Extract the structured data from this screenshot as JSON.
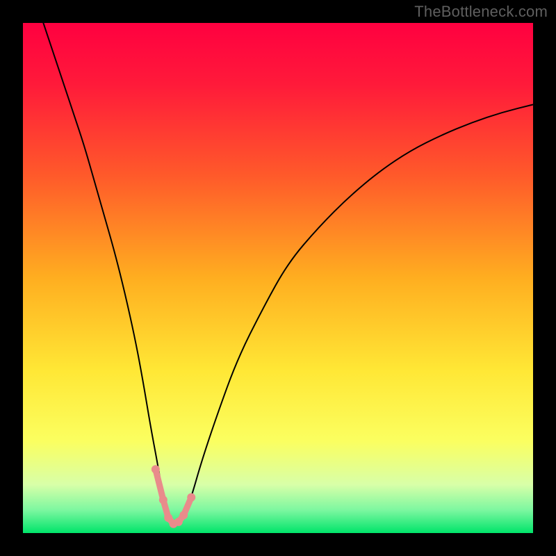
{
  "watermark": "TheBottleneck.com",
  "chart_data": {
    "type": "line",
    "title": "",
    "xlabel": "",
    "ylabel": "",
    "xlim": [
      0,
      100
    ],
    "ylim": [
      0,
      100
    ],
    "background": {
      "kind": "vertical-gradient",
      "stops": [
        {
          "pos": 0.0,
          "color": "#ff0040"
        },
        {
          "pos": 0.12,
          "color": "#ff1a3a"
        },
        {
          "pos": 0.3,
          "color": "#ff5a2a"
        },
        {
          "pos": 0.5,
          "color": "#ffae20"
        },
        {
          "pos": 0.68,
          "color": "#ffe735"
        },
        {
          "pos": 0.82,
          "color": "#fbff60"
        },
        {
          "pos": 0.905,
          "color": "#d8ffa8"
        },
        {
          "pos": 0.955,
          "color": "#7cf7a0"
        },
        {
          "pos": 1.0,
          "color": "#00e46a"
        }
      ]
    },
    "series": [
      {
        "name": "bottleneck-curve",
        "stroke": "#000000",
        "stroke_width": 2,
        "x": [
          4,
          6,
          8,
          10,
          12,
          14,
          16,
          18,
          20,
          22,
          23.5,
          25,
          26.5,
          27.5,
          28.5,
          30,
          31.5,
          33,
          35,
          38,
          42,
          47,
          52,
          58,
          64,
          70,
          76,
          82,
          88,
          94,
          100
        ],
        "y_pct": [
          100,
          94,
          88,
          82,
          76,
          69,
          62,
          55,
          47,
          38,
          30,
          21,
          13,
          7,
          3,
          1.5,
          3,
          7,
          14,
          23,
          34,
          44,
          53,
          60,
          66,
          71,
          75,
          78,
          80.5,
          82.5,
          84
        ]
      }
    ],
    "markers": {
      "name": "min-region",
      "color": "#e98b8b",
      "stroke": "#e98b8b",
      "radius": 6,
      "line_width": 9,
      "x": [
        26.0,
        27.5,
        28.5,
        29.5,
        30.5,
        31.5,
        33.0
      ],
      "y_pct": [
        12.5,
        6.5,
        3.0,
        1.8,
        2.2,
        3.5,
        7.0
      ]
    }
  }
}
